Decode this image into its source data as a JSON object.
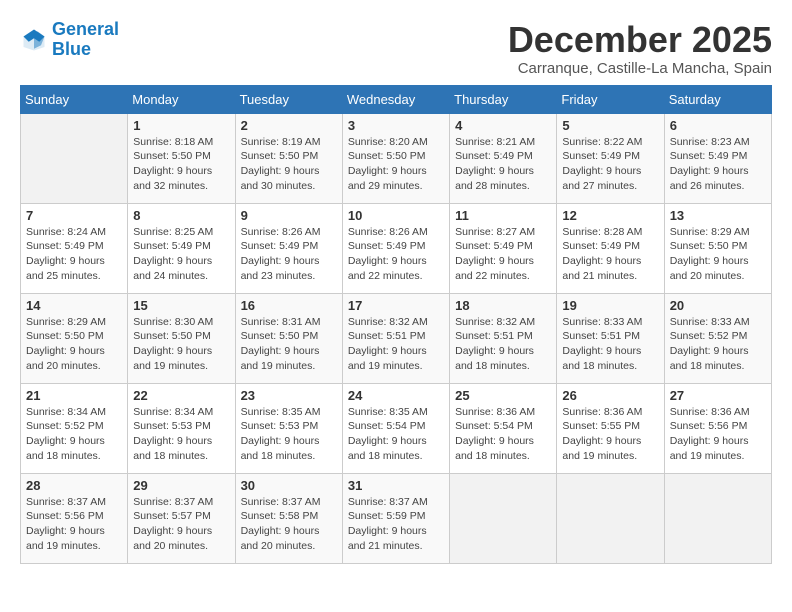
{
  "logo": {
    "line1": "General",
    "line2": "Blue"
  },
  "title": "December 2025",
  "location": "Carranque, Castille-La Mancha, Spain",
  "weekdays": [
    "Sunday",
    "Monday",
    "Tuesday",
    "Wednesday",
    "Thursday",
    "Friday",
    "Saturday"
  ],
  "weeks": [
    [
      {
        "day": "",
        "info": ""
      },
      {
        "day": "1",
        "info": "Sunrise: 8:18 AM\nSunset: 5:50 PM\nDaylight: 9 hours\nand 32 minutes."
      },
      {
        "day": "2",
        "info": "Sunrise: 8:19 AM\nSunset: 5:50 PM\nDaylight: 9 hours\nand 30 minutes."
      },
      {
        "day": "3",
        "info": "Sunrise: 8:20 AM\nSunset: 5:50 PM\nDaylight: 9 hours\nand 29 minutes."
      },
      {
        "day": "4",
        "info": "Sunrise: 8:21 AM\nSunset: 5:49 PM\nDaylight: 9 hours\nand 28 minutes."
      },
      {
        "day": "5",
        "info": "Sunrise: 8:22 AM\nSunset: 5:49 PM\nDaylight: 9 hours\nand 27 minutes."
      },
      {
        "day": "6",
        "info": "Sunrise: 8:23 AM\nSunset: 5:49 PM\nDaylight: 9 hours\nand 26 minutes."
      }
    ],
    [
      {
        "day": "7",
        "info": "Sunrise: 8:24 AM\nSunset: 5:49 PM\nDaylight: 9 hours\nand 25 minutes."
      },
      {
        "day": "8",
        "info": "Sunrise: 8:25 AM\nSunset: 5:49 PM\nDaylight: 9 hours\nand 24 minutes."
      },
      {
        "day": "9",
        "info": "Sunrise: 8:26 AM\nSunset: 5:49 PM\nDaylight: 9 hours\nand 23 minutes."
      },
      {
        "day": "10",
        "info": "Sunrise: 8:26 AM\nSunset: 5:49 PM\nDaylight: 9 hours\nand 22 minutes."
      },
      {
        "day": "11",
        "info": "Sunrise: 8:27 AM\nSunset: 5:49 PM\nDaylight: 9 hours\nand 22 minutes."
      },
      {
        "day": "12",
        "info": "Sunrise: 8:28 AM\nSunset: 5:49 PM\nDaylight: 9 hours\nand 21 minutes."
      },
      {
        "day": "13",
        "info": "Sunrise: 8:29 AM\nSunset: 5:50 PM\nDaylight: 9 hours\nand 20 minutes."
      }
    ],
    [
      {
        "day": "14",
        "info": "Sunrise: 8:29 AM\nSunset: 5:50 PM\nDaylight: 9 hours\nand 20 minutes."
      },
      {
        "day": "15",
        "info": "Sunrise: 8:30 AM\nSunset: 5:50 PM\nDaylight: 9 hours\nand 19 minutes."
      },
      {
        "day": "16",
        "info": "Sunrise: 8:31 AM\nSunset: 5:50 PM\nDaylight: 9 hours\nand 19 minutes."
      },
      {
        "day": "17",
        "info": "Sunrise: 8:32 AM\nSunset: 5:51 PM\nDaylight: 9 hours\nand 19 minutes."
      },
      {
        "day": "18",
        "info": "Sunrise: 8:32 AM\nSunset: 5:51 PM\nDaylight: 9 hours\nand 18 minutes."
      },
      {
        "day": "19",
        "info": "Sunrise: 8:33 AM\nSunset: 5:51 PM\nDaylight: 9 hours\nand 18 minutes."
      },
      {
        "day": "20",
        "info": "Sunrise: 8:33 AM\nSunset: 5:52 PM\nDaylight: 9 hours\nand 18 minutes."
      }
    ],
    [
      {
        "day": "21",
        "info": "Sunrise: 8:34 AM\nSunset: 5:52 PM\nDaylight: 9 hours\nand 18 minutes."
      },
      {
        "day": "22",
        "info": "Sunrise: 8:34 AM\nSunset: 5:53 PM\nDaylight: 9 hours\nand 18 minutes."
      },
      {
        "day": "23",
        "info": "Sunrise: 8:35 AM\nSunset: 5:53 PM\nDaylight: 9 hours\nand 18 minutes."
      },
      {
        "day": "24",
        "info": "Sunrise: 8:35 AM\nSunset: 5:54 PM\nDaylight: 9 hours\nand 18 minutes."
      },
      {
        "day": "25",
        "info": "Sunrise: 8:36 AM\nSunset: 5:54 PM\nDaylight: 9 hours\nand 18 minutes."
      },
      {
        "day": "26",
        "info": "Sunrise: 8:36 AM\nSunset: 5:55 PM\nDaylight: 9 hours\nand 19 minutes."
      },
      {
        "day": "27",
        "info": "Sunrise: 8:36 AM\nSunset: 5:56 PM\nDaylight: 9 hours\nand 19 minutes."
      }
    ],
    [
      {
        "day": "28",
        "info": "Sunrise: 8:37 AM\nSunset: 5:56 PM\nDaylight: 9 hours\nand 19 minutes."
      },
      {
        "day": "29",
        "info": "Sunrise: 8:37 AM\nSunset: 5:57 PM\nDaylight: 9 hours\nand 20 minutes."
      },
      {
        "day": "30",
        "info": "Sunrise: 8:37 AM\nSunset: 5:58 PM\nDaylight: 9 hours\nand 20 minutes."
      },
      {
        "day": "31",
        "info": "Sunrise: 8:37 AM\nSunset: 5:59 PM\nDaylight: 9 hours\nand 21 minutes."
      },
      {
        "day": "",
        "info": ""
      },
      {
        "day": "",
        "info": ""
      },
      {
        "day": "",
        "info": ""
      }
    ]
  ]
}
